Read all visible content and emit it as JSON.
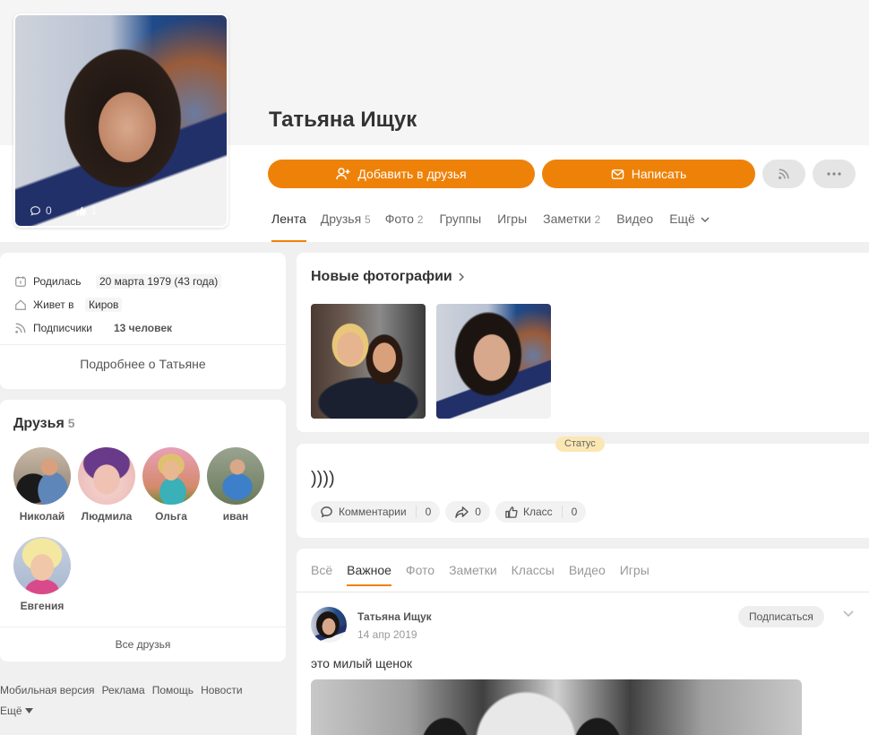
{
  "profile": {
    "name": "Татьяна Ищук",
    "avatar_comments": "0",
    "avatar_likes": "1"
  },
  "actions": {
    "add_friend": "Добавить в друзья",
    "write": "Написать"
  },
  "tabs": [
    {
      "label": "Лента",
      "count": ""
    },
    {
      "label": "Друзья",
      "count": "5"
    },
    {
      "label": "Фото",
      "count": "2"
    },
    {
      "label": "Группы",
      "count": ""
    },
    {
      "label": "Игры",
      "count": ""
    },
    {
      "label": "Заметки",
      "count": "2"
    },
    {
      "label": "Видео",
      "count": ""
    },
    {
      "label": "Ещё",
      "count": ""
    }
  ],
  "info": {
    "born_label": "Родилась",
    "born_value": "20 марта 1979 (43 года)",
    "lives_label": "Живет в",
    "lives_value": "Киров",
    "subs_label": "Подписчики",
    "subs_value": "13 человек",
    "more": "Подробнее о Татьяне"
  },
  "friends": {
    "title": "Друзья",
    "count": "5",
    "items": [
      {
        "name": "Николай"
      },
      {
        "name": "Людмила"
      },
      {
        "name": "Ольга"
      },
      {
        "name": "иван"
      },
      {
        "name": "Евгения"
      }
    ],
    "all": "Все друзья"
  },
  "footer": {
    "links": [
      "Мобильная версия",
      "Реклама",
      "Помощь",
      "Новости"
    ],
    "more": "Ещё"
  },
  "photos": {
    "title": "Новые фотографии"
  },
  "status": {
    "badge": "Статус",
    "text": "))))",
    "comments_label": "Комментарии",
    "comments_count": "0",
    "shares_count": "0",
    "class_label": "Класс",
    "class_count": "0"
  },
  "feed_tabs": [
    "Всё",
    "Важное",
    "Фото",
    "Заметки",
    "Классы",
    "Видео",
    "Игры"
  ],
  "post": {
    "author": "Татьяна Ищук",
    "date": "14 апр 2019",
    "subscribe": "Подписаться",
    "text": "это милый щенок"
  },
  "colors": {
    "accent": "#ee8208",
    "background": "#f0f0f0"
  }
}
